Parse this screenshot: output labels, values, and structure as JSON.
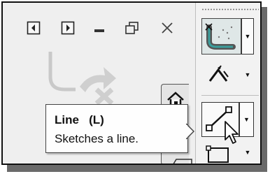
{
  "window_controls": {
    "icons": [
      "panel-left-icon",
      "panel-right-icon",
      "minimize-icon",
      "restore-icon",
      "close-icon"
    ]
  },
  "ribbon": {
    "buttons": [
      {
        "icon": "spline-sketch-icon",
        "has_dropdown": true
      },
      {
        "icon": "dimension-icon",
        "has_dropdown": true
      },
      {
        "icon": "line-icon",
        "has_dropdown": true
      },
      {
        "icon": "rectangle-icon",
        "has_dropdown": true
      }
    ]
  },
  "tooltip": {
    "title": "Line   (L)",
    "description": "Sketches a line."
  },
  "colors": {
    "background": "#efefef",
    "frame_border": "#111111",
    "shadow": "#6a6a6a",
    "tooltip_bg": "#fefefe",
    "spline_accent": "#3b9e9c"
  }
}
